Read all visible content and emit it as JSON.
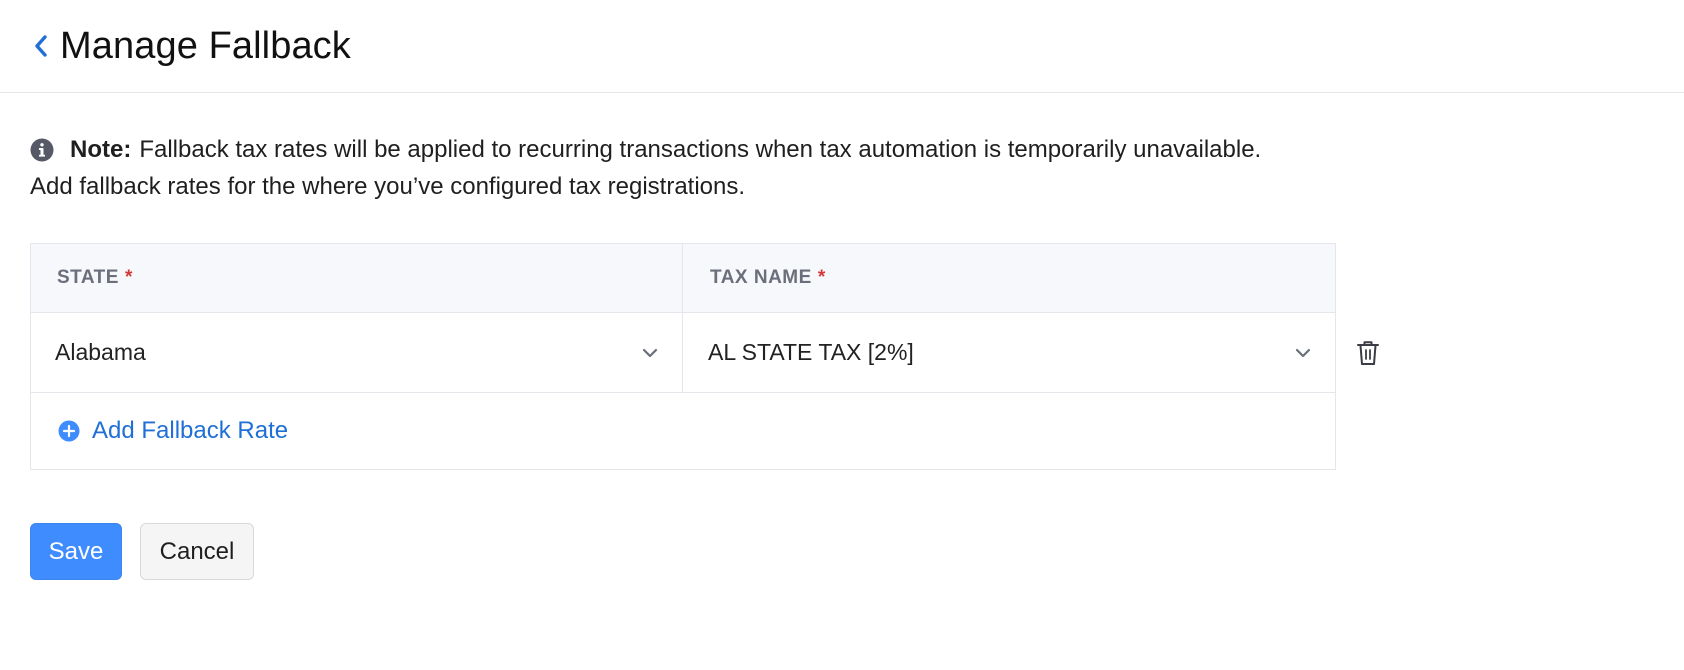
{
  "header": {
    "title": "Manage Fallback"
  },
  "note": {
    "label": "Note:",
    "line1": "Fallback tax rates will be applied to recurring transactions when tax automation is temporarily unavailable.",
    "line2": "Add fallback rates for the where you’ve configured tax registrations."
  },
  "table": {
    "columns": {
      "state": "STATE",
      "tax_name": "TAX NAME",
      "required_marker": "*"
    },
    "rows": [
      {
        "state": "Alabama",
        "tax_name": "AL STATE TAX [2%]"
      }
    ],
    "add_label": "Add Fallback Rate"
  },
  "actions": {
    "save_label": "Save",
    "cancel_label": "Cancel"
  },
  "colors": {
    "accent": "#3f8cff",
    "link": "#1f6fd6",
    "required": "#d23a3a"
  },
  "icons": {
    "back": "chevron-left-icon",
    "info": "info-icon",
    "dropdown": "chevron-down-icon",
    "delete": "trash-icon",
    "add": "plus-circle-icon"
  }
}
